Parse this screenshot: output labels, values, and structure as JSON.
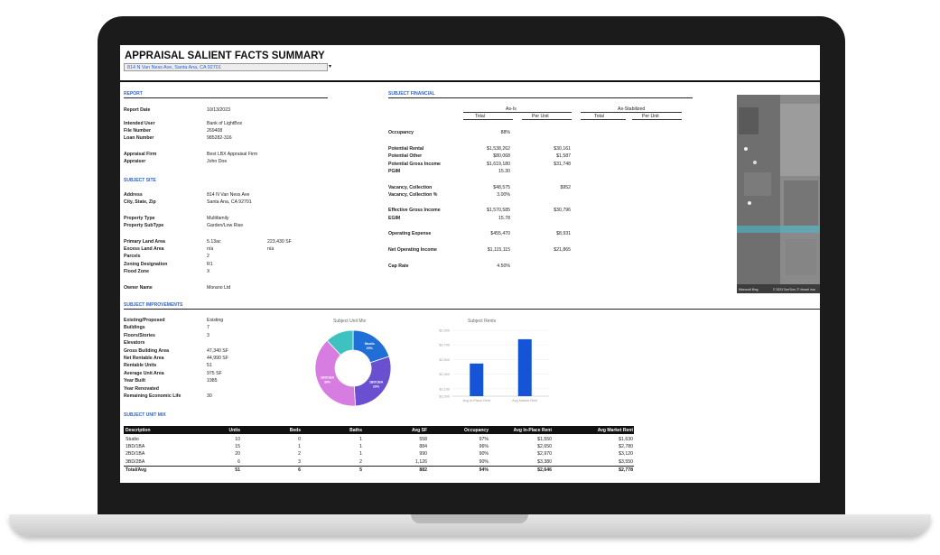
{
  "title": "APPRAISAL SALIENT FACTS SUMMARY",
  "address_select": {
    "value": "814 N Van Ness Ave, Santa Ana, CA 92701",
    "arrow": "▾"
  },
  "report": {
    "header": "REPORT",
    "rows": [
      {
        "label": "Report Date",
        "value": "10/13/2023"
      },
      {
        "label": "Intended User",
        "value": "Bank of LightBox"
      },
      {
        "label": "File Number",
        "value": "269408"
      },
      {
        "label": "Loan Number",
        "value": "985282-316"
      },
      {
        "label": "Appraisal Firm",
        "value": "Best LBX Appraisal Firm"
      },
      {
        "label": "Appraiser",
        "value": "John Doe"
      }
    ]
  },
  "subject_site": {
    "header": "SUBJECT SITE",
    "rows": [
      {
        "label": "Address",
        "value": "814 N Van Ness Ave",
        "value2": ""
      },
      {
        "label": "City, State, Zip",
        "value": "Santa Ana, CA 92701",
        "value2": ""
      },
      {
        "label": "Property Type",
        "value": "Multifamily",
        "value2": ""
      },
      {
        "label": "Property SubType",
        "value": "Garden/Low Rise",
        "value2": ""
      },
      {
        "label": "Primary Land Area",
        "value": "5.13ac",
        "value2": "223,430 SF"
      },
      {
        "label": "Excess Land Area",
        "value": "n/a",
        "value2": "n/a"
      },
      {
        "label": "Parcels",
        "value": "2",
        "value2": ""
      },
      {
        "label": "Zoning Designation",
        "value": "R1",
        "value2": ""
      },
      {
        "label": "Flood Zone",
        "value": "X",
        "value2": ""
      },
      {
        "label": "Owner Name",
        "value": "Morano Ltd",
        "value2": ""
      }
    ]
  },
  "financial": {
    "header": "SUBJECT FINANCIAL",
    "as_is": "As-Is",
    "as_stabilized": "As-Stabilized",
    "col_total": "Total",
    "col_per_unit": "Per Unit",
    "rows": [
      {
        "label": "Occupancy",
        "total": "88%",
        "per_unit": ""
      },
      {
        "label": "Potential Rental",
        "total": "$1,538,262",
        "per_unit": "$30,161"
      },
      {
        "label": "Potential Other",
        "total": "$80,068",
        "per_unit": "$1,587"
      },
      {
        "label": "Potential Gross Income",
        "total": "$1,619,180",
        "per_unit": "$31,748"
      },
      {
        "label": "PGIM",
        "total": "15.30",
        "per_unit": ""
      },
      {
        "label": "Vacancy, Collection",
        "total": "$48,575",
        "per_unit": "$952"
      },
      {
        "label": "Vacancy, Collection %",
        "total": "3.00%",
        "per_unit": ""
      },
      {
        "label": "Effective Gross Income",
        "total": "$1,570,585",
        "per_unit": "$30,796"
      },
      {
        "label": "EGIM",
        "total": "15.78",
        "per_unit": ""
      },
      {
        "label": "Operating Expense",
        "total": "$455,470",
        "per_unit": "$8,931"
      },
      {
        "label": "Net Operating Income",
        "total": "$1,115,115",
        "per_unit": "$21,865"
      },
      {
        "label": "Cap Rate",
        "total": "4.50%",
        "per_unit": ""
      }
    ]
  },
  "improvements": {
    "header": "SUBJECT IMPROVEMENTS",
    "rows": [
      {
        "label": "Existing/Proposed",
        "value": "Existing"
      },
      {
        "label": "Buildings",
        "value": "7"
      },
      {
        "label": "Floors/Stories",
        "value": "3"
      },
      {
        "label": "Elevators",
        "value": ""
      },
      {
        "label": "Gross Building Area",
        "value": "47,340 SF"
      },
      {
        "label": "Net Rentable Area",
        "value": "44,990 SF"
      },
      {
        "label": "Rentable Units",
        "value": "51"
      },
      {
        "label": "Average Unit Area",
        "value": "975 SF"
      },
      {
        "label": "Year Built",
        "value": "1985"
      },
      {
        "label": "Year Renovated",
        "value": ""
      },
      {
        "label": "Remaining Economic Life",
        "value": "30"
      }
    ]
  },
  "photo_caption": {
    "left": "Microsoft Bing",
    "right": "© 2023 TomTom, © Vexcel Ima"
  },
  "colors": {
    "accent": "#2a64d6",
    "studio": "#1f6fd6",
    "br1": "#6a4fd1",
    "br2": "#d77ce0",
    "br3": "#3ec1c1",
    "bar": "#1554d6"
  },
  "chart_data": [
    {
      "type": "pie",
      "title": "Subject Unit Mix",
      "categories": [
        "Studio",
        "1BD/1BA",
        "2BD/1BA",
        "3BD/2BA"
      ],
      "values": [
        20,
        29,
        39,
        12
      ],
      "labels": [
        "Studio 20%",
        "1BD/1BA 29%",
        "2BD/1BA 39%",
        ""
      ]
    },
    {
      "type": "bar",
      "title": "Subject Rents",
      "categories": [
        "Avg In-Place Rent",
        "Avg Market Rent"
      ],
      "values": [
        2446,
        2778
      ],
      "ylim": [
        2000,
        2900
      ],
      "yticks": [
        "$2,900",
        "$2,700",
        "$2,500",
        "$2,300",
        "$2,100",
        "$2,000"
      ]
    }
  ],
  "unit_mix": {
    "header": "SUBJECT UNIT MIX",
    "columns": [
      "Description",
      "Units",
      "Beds",
      "Baths",
      "Avg SF",
      "Occupancy",
      "Avg In-Place Rent",
      "Avg Market Rent"
    ],
    "rows": [
      [
        "Studio",
        "10",
        "0",
        "1",
        "558",
        "97%",
        "$1,550",
        "$1,630"
      ],
      [
        "1BD/1BA",
        "15",
        "1",
        "1",
        "884",
        "96%",
        "$2,650",
        "$2,780"
      ],
      [
        "2BD/1BA",
        "20",
        "2",
        "1",
        "990",
        "90%",
        "$2,970",
        "$3,120"
      ],
      [
        "3BD/2BA",
        "6",
        "3",
        "2",
        "1,126",
        "90%",
        "$3,380",
        "$3,550"
      ]
    ],
    "total": [
      "Total/Avg",
      "51",
      "6",
      "5",
      "882",
      "94%",
      "$2,646",
      "$2,778"
    ]
  }
}
